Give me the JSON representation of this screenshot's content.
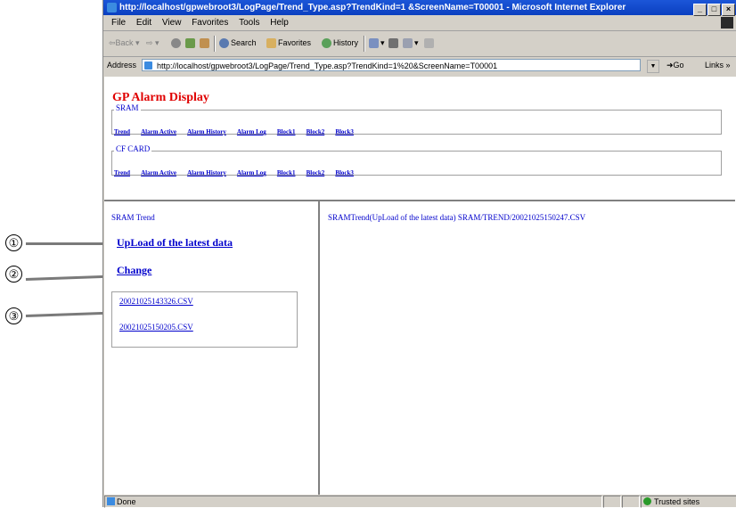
{
  "window": {
    "title": "http://localhost/gpwebroot3/LogPage/Trend_Type.asp?TrendKind=1 &ScreenName=T00001 - Microsoft Internet Explorer",
    "min_glyph": "_",
    "max_glyph": "□",
    "close_glyph": "×"
  },
  "menu": [
    "File",
    "Edit",
    "View",
    "Favorites",
    "Tools",
    "Help"
  ],
  "toolbar": {
    "back": "⇦Back ▾",
    "forward": "⇨ ▾",
    "search": "Search",
    "favorites": "Favorites",
    "history": "History"
  },
  "address": {
    "label": "Address",
    "url": "http://localhost/gpwebroot3/LogPage/Trend_Type.asp?TrendKind=1%20&ScreenName=T00001",
    "go": "Go",
    "links": "Links"
  },
  "app": {
    "title": "GP Alarm Display",
    "sram": {
      "legend": "SRAM",
      "links": [
        "Trend",
        "Alarm Active",
        "Alarm History",
        "Alarm Log",
        "Block1",
        "Block2",
        "Block3"
      ]
    },
    "cf": {
      "legend": "CF CARD",
      "links": [
        "Trend",
        "Alarm Active",
        "Alarm History",
        "Alarm Log",
        "Block1",
        "Block2",
        "Block3"
      ]
    }
  },
  "left": {
    "heading": "SRAM Trend",
    "upload_link": "UpLoad of the latest data",
    "change_link": "Change",
    "files": [
      "20021025143326.CSV",
      "20021025150205.CSV"
    ]
  },
  "right": {
    "text": "SRAMTrend(UpLoad of the latest data) SRAM/TREND/20021025150247.CSV"
  },
  "status": {
    "left": "Done",
    "zone": "Trusted sites"
  },
  "callouts": [
    "①",
    "②",
    "③"
  ],
  "colors": {
    "title_red": "#e00000",
    "link_blue": "#0000cc",
    "titlebar_blue": "#0a3fc0"
  }
}
